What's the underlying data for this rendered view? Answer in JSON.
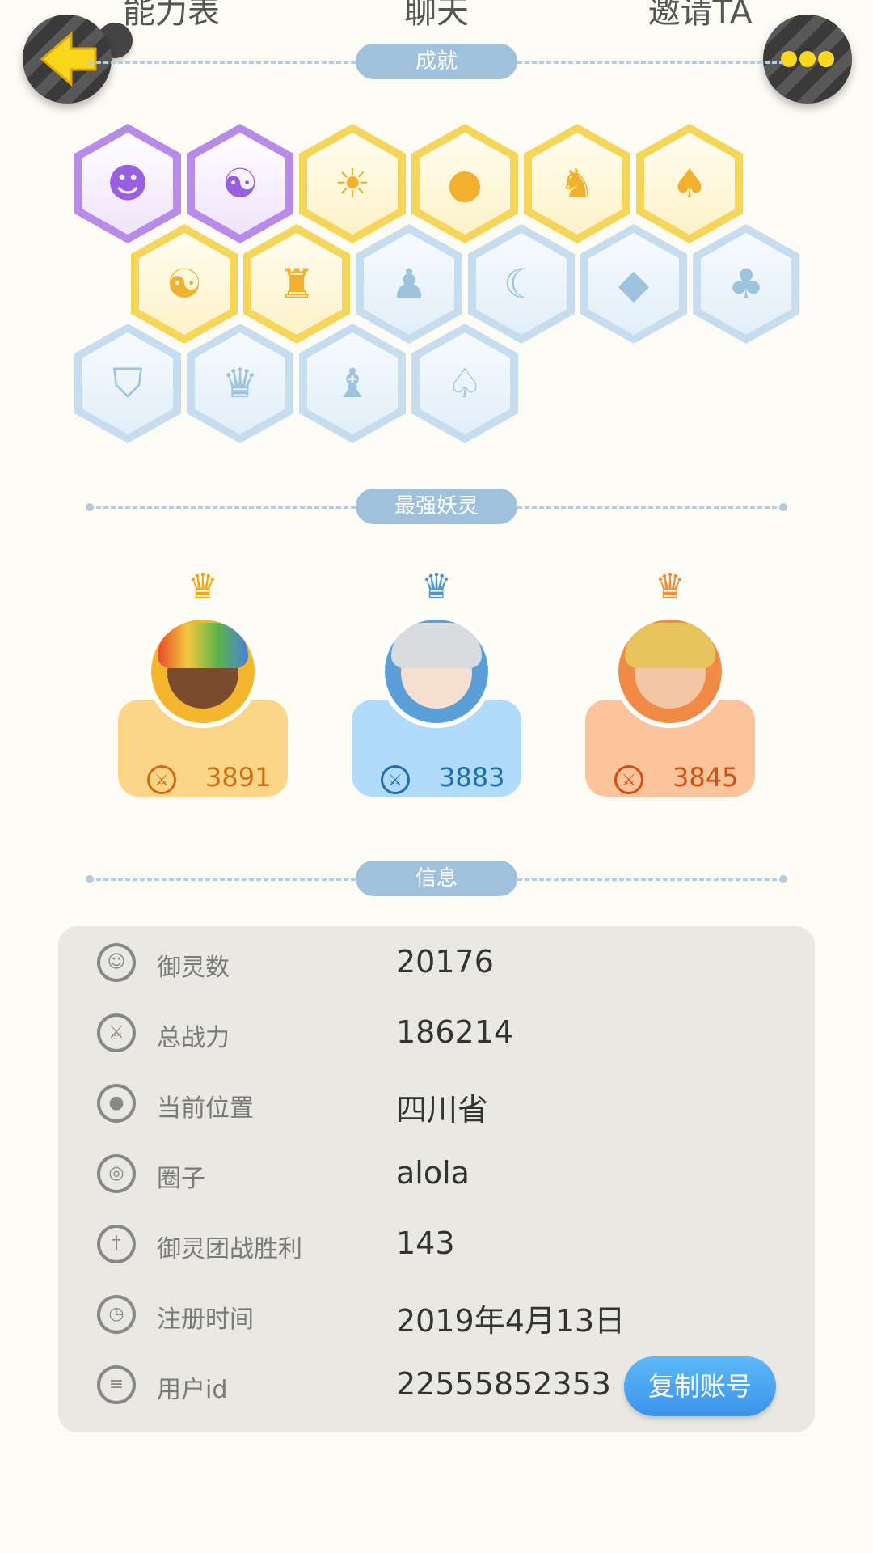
{
  "top_tabs": [
    "能力表",
    "聊天",
    "邀请TA"
  ],
  "sections": {
    "achievements": "成就",
    "strongest": "最强妖灵",
    "info": "信息"
  },
  "achievements": [
    {
      "icon": "demon-face-icon",
      "tier": "purple"
    },
    {
      "icon": "yin-yang-orb-icon",
      "tier": "purple"
    },
    {
      "icon": "sun-tree-icon",
      "tier": "gold"
    },
    {
      "icon": "egg-icon",
      "tier": "gold"
    },
    {
      "icon": "cat-cart-icon",
      "tier": "gold"
    },
    {
      "icon": "fox-balloon-icon",
      "tier": "gold"
    },
    {
      "icon": "yin-yang-book-icon",
      "tier": "gold"
    },
    {
      "icon": "dragon-icon",
      "tier": "gold"
    },
    {
      "icon": "sneaker-icon",
      "tier": "locked"
    },
    {
      "icon": "moon-icon",
      "tier": "locked"
    },
    {
      "icon": "crystal-icon",
      "tier": "locked"
    },
    {
      "icon": "sprite-icon",
      "tier": "locked"
    },
    {
      "icon": "shield-icon",
      "tier": "locked"
    },
    {
      "icon": "gargoyle-icon",
      "tier": "locked"
    },
    {
      "icon": "cat-statue-icon",
      "tier": "locked"
    },
    {
      "icon": "fox-book-icon",
      "tier": "locked"
    }
  ],
  "spirits": [
    {
      "power": "3891",
      "tier": "gold"
    },
    {
      "power": "3883",
      "tier": "blue"
    },
    {
      "power": "3845",
      "tier": "orange"
    }
  ],
  "info_rows": [
    {
      "label": "御灵数",
      "value": "20176",
      "icon": "spirit-count-icon"
    },
    {
      "label": "总战力",
      "value": "186214",
      "icon": "sword-icon"
    },
    {
      "label": "当前位置",
      "value": "四川省",
      "icon": "location-pin-icon"
    },
    {
      "label": "圈子",
      "value": "alola",
      "icon": "circle-target-icon"
    },
    {
      "label": "御灵团战胜利",
      "value": "143",
      "icon": "trophy-sword-icon"
    },
    {
      "label": "注册时间",
      "value": "2019年4月13日",
      "icon": "clock-icon"
    },
    {
      "label": "用户id",
      "value": "22555852353",
      "icon": "id-card-icon"
    }
  ],
  "copy_button": "复制账号",
  "colors": {
    "background": "#fdfcf4",
    "section_pill": "#9fc1dc",
    "copy_button": "#4aa6f2",
    "info_panel": "#e9e8e2"
  }
}
